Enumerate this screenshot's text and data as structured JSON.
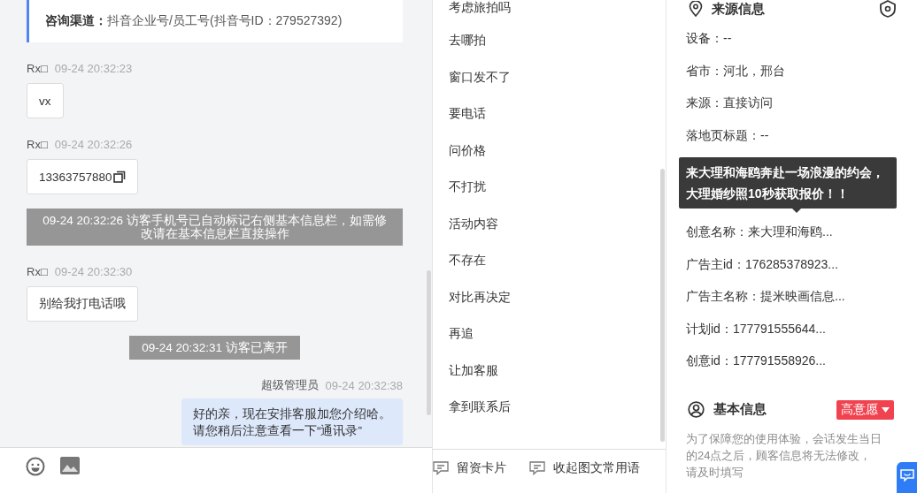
{
  "channel_card": {
    "label": "咨询渠道：",
    "value": "抖音企业号/员工号(抖音号ID：279527392)"
  },
  "messages": [
    {
      "kind": "visitor",
      "sender": "Rx□",
      "time": "09-24 20:32:23",
      "text": "vx",
      "copy": false
    },
    {
      "kind": "visitor",
      "sender": "Rx□",
      "time": "09-24 20:32:26",
      "text": "13363757880",
      "copy": true
    },
    {
      "kind": "system",
      "text": "09-24 20:32:26 访客手机号已自动标记右侧基本信息栏，如需修改请在基本信息栏直接操作"
    },
    {
      "kind": "visitor",
      "sender": "Rx□",
      "time": "09-24 20:32:30",
      "text": "别给我打电话哦",
      "copy": false
    },
    {
      "kind": "system",
      "text": "09-24 20:32:31 访客已离开"
    },
    {
      "kind": "agent",
      "sender": "超级管理员",
      "time": "09-24 20:32:38",
      "text": "好的亲，现在安排客服加您介绍哈。请您稍后注意查看一下“通讯录”",
      "copy": false
    }
  ],
  "quick_replies": [
    "考虑旅拍吗",
    "去哪拍",
    "窗口发不了",
    "要电话",
    "问价格",
    "不打扰",
    "活动内容",
    "不存在",
    "对比再决定",
    "再追",
    "让加客服",
    "拿到联系后"
  ],
  "toolbar": [
    {
      "label": "留资卡片"
    },
    {
      "label": "收起图文常用语"
    }
  ],
  "source_info": {
    "title": "来源信息",
    "items": [
      {
        "kind": "field",
        "text": "设备：--"
      },
      {
        "kind": "field",
        "text": "省市：河北，邢台"
      },
      {
        "kind": "field",
        "text": "来源：直接访问"
      },
      {
        "kind": "field",
        "text": "落地页标题：--"
      },
      {
        "kind": "tooltip",
        "text": "来大理和海鸥奔赴一场浪漫的约会，大理婚纱照10秒获取报价！！"
      },
      {
        "kind": "field",
        "text": "创意名称：来大理和海鸥..."
      },
      {
        "kind": "field",
        "text": "广告主id：176285378923..."
      },
      {
        "kind": "field",
        "text": "广告主名称：提米映画信息..."
      },
      {
        "kind": "field",
        "text": "计划id：177791555644..."
      },
      {
        "kind": "field",
        "text": "创意id：177791558926..."
      }
    ]
  },
  "basic_info": {
    "title": "基本信息",
    "tag": "高意愿",
    "notice": "为了保障您的使用体验，会话发生当日的24点之后，顾客信息将无法修改，请及时填写"
  }
}
